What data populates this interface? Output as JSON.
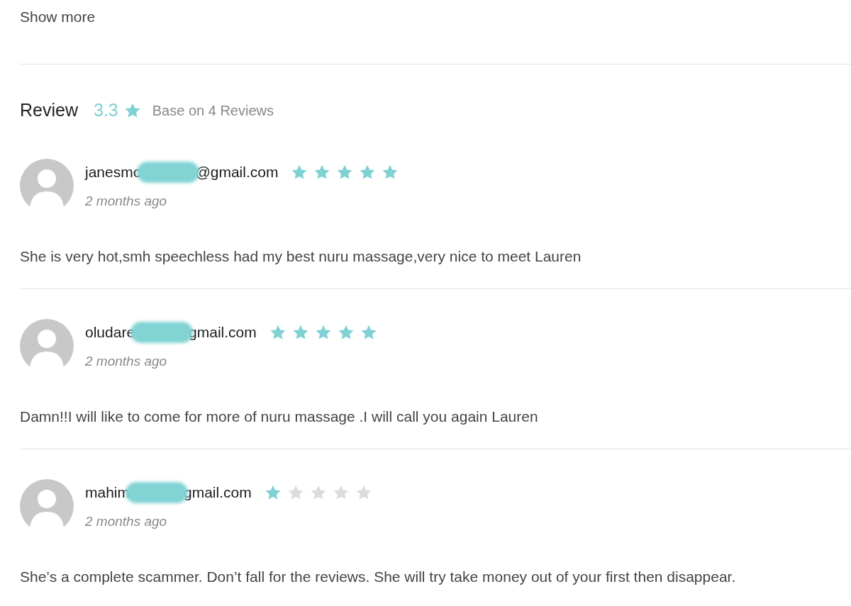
{
  "show_more": "Show more",
  "review_header": {
    "title": "Review",
    "score": "3.3",
    "summary": "Base on 4 Reviews"
  },
  "reviews": [
    {
      "email_start": "janesmo",
      "email_end": "@gmail.com",
      "stars": 5,
      "time": "2 months ago",
      "text": "She is very hot,smh speechless had my best nuru massage,very nice to meet Lauren"
    },
    {
      "email_start": "oludare",
      "email_end": "gmail.com",
      "stars": 5,
      "time": "2 months ago",
      "text": "Damn!!I will like to come for more of nuru massage .I will call you again Lauren"
    },
    {
      "email_start": "mahim",
      "email_end": "gmail.com",
      "stars": 1,
      "time": "2 months ago",
      "text": "She’s a complete scammer. Don’t fall for the reviews. She will try take money out of your first then disappear."
    }
  ]
}
